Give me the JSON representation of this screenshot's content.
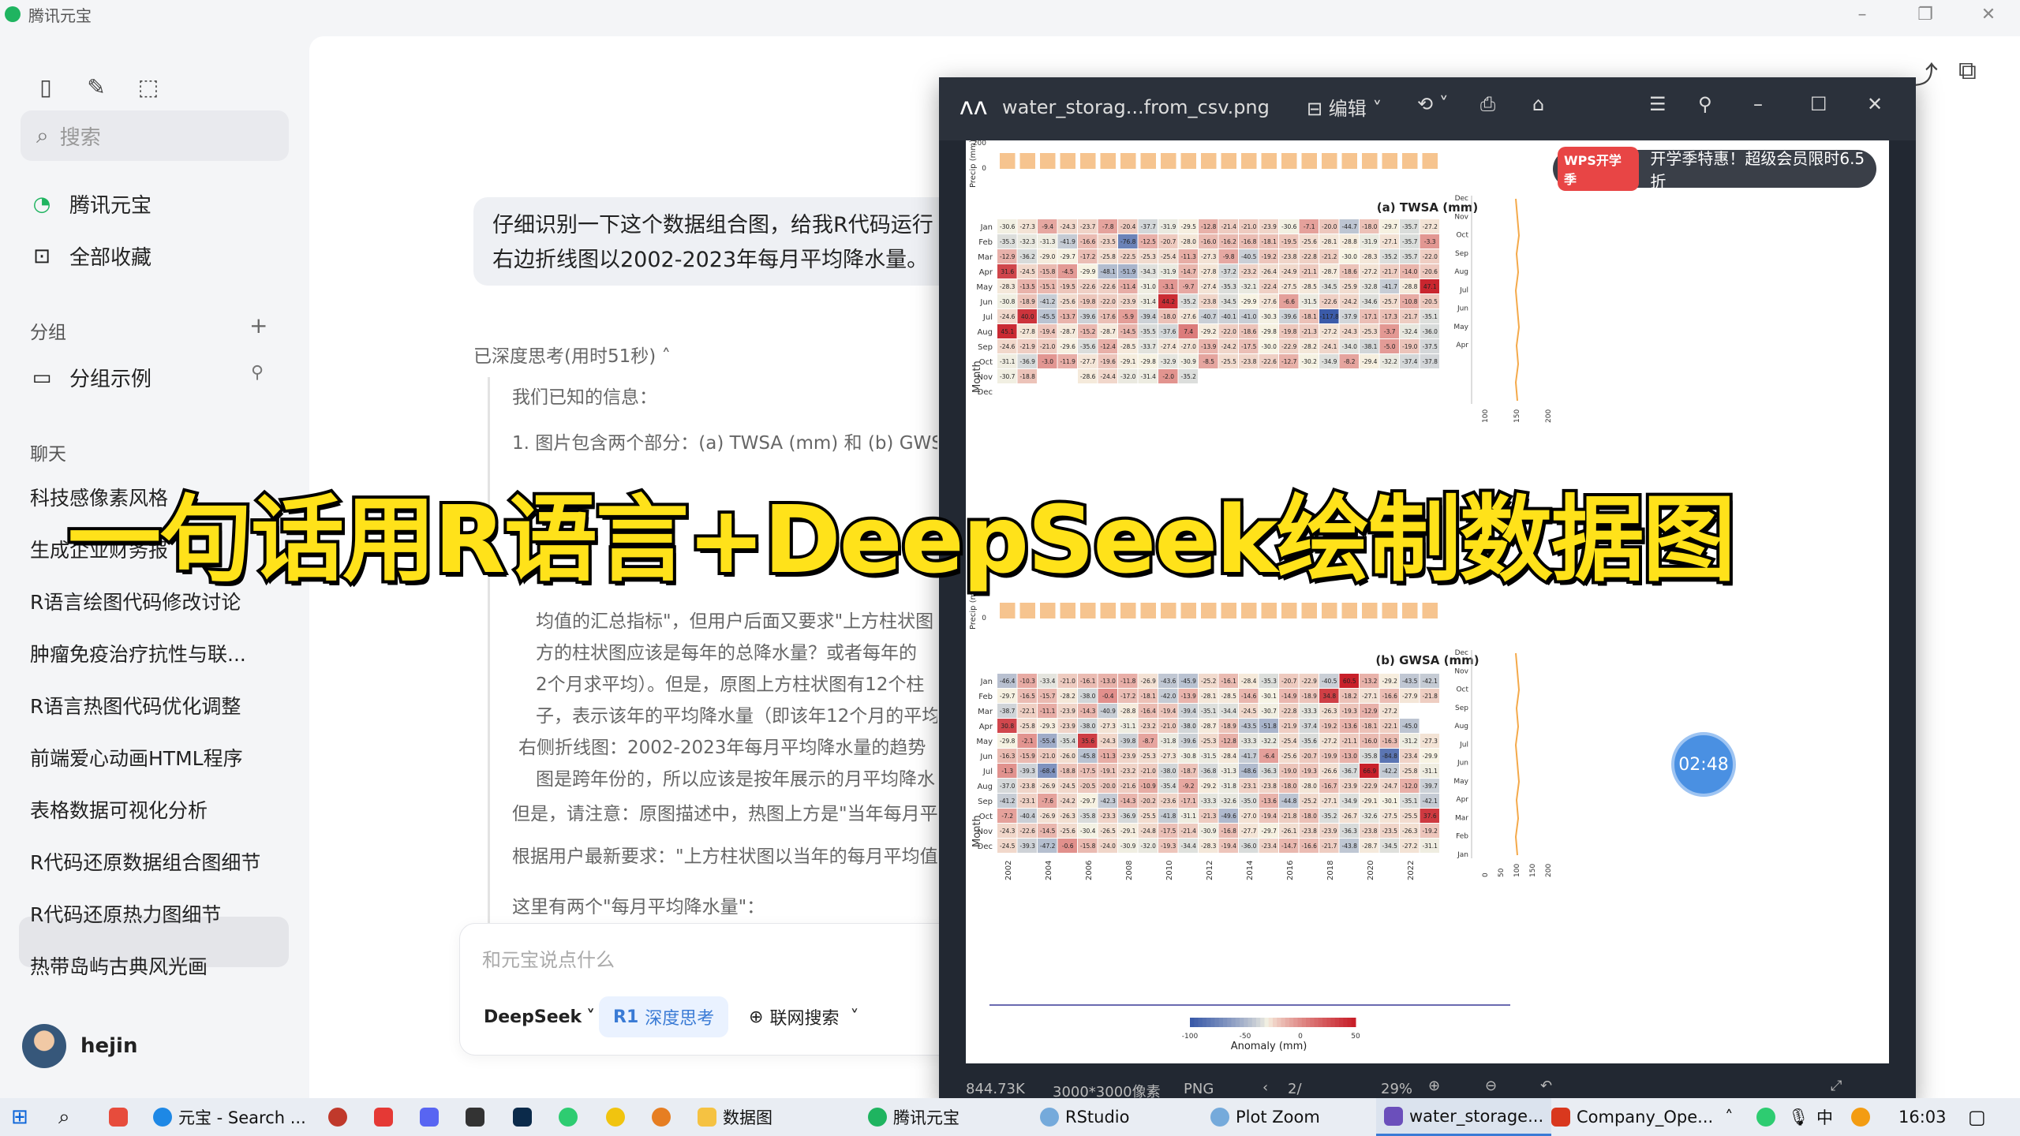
{
  "window": {
    "title": "腾讯元宝"
  },
  "sidebar": {
    "search_placeholder": "搜索",
    "nav": [
      {
        "label": "腾讯元宝"
      },
      {
        "label": "全部收藏"
      }
    ],
    "groups_label": "分组",
    "group_items": [
      {
        "label": "分组示例"
      }
    ],
    "chats_label": "聊天",
    "chats": [
      {
        "label": "科技感像素风格"
      },
      {
        "label": "生成企业财务报"
      },
      {
        "label": "R语言绘图代码修改讨论"
      },
      {
        "label": "肿瘤免疫治疗抗性与联..."
      },
      {
        "label": "R语言热图代码优化调整"
      },
      {
        "label": "前端爱心动画HTML程序"
      },
      {
        "label": "表格数据可视化分析"
      },
      {
        "label": "R代码还原数据组合图细节"
      },
      {
        "label": "R代码还原热力图细节"
      },
      {
        "label": "热带岛屿古典风光画"
      }
    ],
    "active_chat_index": 8,
    "user_name": "hejin"
  },
  "conversation": {
    "user_message_line1": "仔细识别一下这个数据组合图，给我R代码运行",
    "user_message_line2": "右边折线图以2002-2023年每月平均降水量。",
    "thinking_status": "已深度思考(用时51秒)",
    "reasoning": [
      "我们已知的信息：",
      "1. 图片包含两个部分：(a) TWSA (mm) 和 (b) GWSA (m",
      "均值的汇总指标\"，但用户后面又要求\"上方柱状图",
      "方的柱状图应该是每年的总降水量？或者每年的",
      "2个月求平均）。但是，原图上方柱状图有12个柱",
      "子，表示该年的平均降水量（即该年12个月的平均",
      "右侧折线图：2002-2023年每月平均降水量的趋势",
      "图是跨年份的，所以应该是按年展示的月平均降水",
      "但是，请注意：原图描述中，热图上方是\"当年每月平",
      "根据用户最新要求：\"上方柱状图以当年的每月平均值",
      "这里有两个\"每月平均降水量\"："
    ],
    "input_placeholder": "和元宝说点什么",
    "model_label": "DeepSeek",
    "deep_think_label": "深度思考",
    "deep_think_badge": "R1",
    "web_search_label": "联网搜索"
  },
  "viewer": {
    "filename": "water_storag...from_csv.png",
    "edit_label": "编辑",
    "status_size": "844.73K",
    "status_dims": "3000*3000像素",
    "status_format": "PNG",
    "status_page": "2/",
    "status_zoom": "29%",
    "banner_tag": "WPS开学季",
    "banner_text": "开学季特惠！超级会员限时6.5折",
    "timer": "02:48"
  },
  "overlay_title": "一句话用R语言+DeepSeek绘制数据图",
  "chart_data": [
    {
      "type": "heatmap",
      "title": "(a) TWSA (mm)",
      "ylabel": "Month",
      "rows": [
        "Jan",
        "Feb",
        "Mar",
        "Apr",
        "May",
        "Jun",
        "Jul",
        "Aug",
        "Sep",
        "Oct",
        "Nov",
        "Dec"
      ],
      "top_bar": {
        "ylabel": "Precip (mm)",
        "ticks": [
          0,
          200
        ]
      },
      "right_line": {
        "ticks": [
          100,
          150,
          200
        ]
      },
      "values": [
        [
          -30.6,
          -27.3,
          -9.4,
          -24.3,
          -23.7,
          -7.8,
          -20.4,
          -37.7,
          -31.9,
          -29.5,
          -12.8,
          -21.4,
          -21.0,
          -23.9,
          -30.6,
          -7.1,
          -20.0,
          -44.7,
          -18.0,
          -29.7,
          -35.7,
          -27.2
        ],
        [
          -35.3,
          -32.3,
          -31.3,
          -41.9,
          -16.6,
          -23.5,
          -76.8,
          -12.5,
          -20.7,
          -28.0,
          -16.0,
          -16.2,
          -16.8,
          -18.1,
          -19.5,
          -25.6,
          -28.1,
          -28.8,
          -31.9,
          -27.1,
          -35.7,
          -3.3
        ],
        [
          -12.9,
          -36.2,
          -29.0,
          -29.7,
          -17.2,
          -25.8,
          -22.5,
          -25.3,
          -25.4,
          -11.3,
          -27.3,
          -9.8,
          -40.5,
          -19.2,
          -23.8,
          -22.8,
          -21.2,
          -30.0,
          -28.3,
          -35.2,
          -35.7,
          -22.0
        ],
        [
          31.6,
          -24.5,
          -15.8,
          -4.5,
          -29.9,
          -48.1,
          -51.9,
          -34.3,
          -31.9,
          -14.7,
          -27.8,
          -37.2,
          -23.2,
          -26.4,
          -24.9,
          -21.1,
          -28.7,
          -18.6,
          -27.2,
          -21.7,
          -14.0,
          -20.6
        ],
        [
          -28.3,
          -13.5,
          -15.1,
          -19.5,
          -22.6,
          -22.6,
          -11.4,
          -31.0,
          -3.1,
          -9.7,
          -27.4,
          -35.3,
          -32.1,
          -22.4,
          -27.5,
          -28.5,
          -34.5,
          -25.9,
          -32.8,
          -41.7,
          -28.8,
          47.1
        ],
        [
          -30.8,
          -18.9,
          -41.2,
          -25.6,
          -19.8,
          -22.0,
          -23.9,
          -31.4,
          44.2,
          -35.2,
          -23.8,
          -34.5,
          -29.9,
          -27.6,
          -6.6,
          -31.5,
          -22.6,
          -24.2,
          -34.6,
          -25.7,
          -10.8,
          -20.5
        ],
        [
          -24.6,
          40.0,
          -45.5,
          -13.7,
          -39.6,
          -17.6,
          -5.9,
          -39.4,
          -18.0,
          -27.6,
          -40.7,
          -40.1,
          -41.0,
          -30.3,
          -39.6,
          -18.1,
          -117.8,
          -37.9,
          -17.1,
          -17.3,
          -21.7,
          -35.1
        ],
        [
          45.1,
          -27.8,
          -19.4,
          -28.7,
          -15.2,
          -28.7,
          -14.5,
          -35.5,
          -37.6,
          7.4,
          -29.2,
          -22.0,
          -18.6,
          -29.8,
          -19.8,
          -21.3,
          -27.2,
          -24.3,
          -25.3,
          -3.7,
          -32.4,
          -36.0
        ],
        [
          -24.6,
          -21.9,
          -21.0,
          -29.6,
          -35.6,
          -12.4,
          -28.5,
          -33.7,
          -27.4,
          -27.0,
          -13.9,
          -24.2,
          -17.5,
          -30.0,
          -22.9,
          -28.2,
          -24.1,
          -34.0,
          -38.1,
          -5.0,
          -19.0,
          -37.5
        ],
        [
          -31.1,
          -36.9,
          -3.0,
          -11.9,
          -27.7,
          -19.6,
          -29.1,
          -29.8,
          -32.9,
          -30.9,
          -8.5,
          -25.5,
          -23.8,
          -22.6,
          -12.7,
          -30.2,
          -34.9,
          -8.2,
          -29.4,
          -32.2,
          -37.4,
          -37.8
        ],
        [
          -30.7,
          -18.8,
          null,
          null,
          -28.6,
          -24.4,
          -32.0,
          -31.4,
          -2.0,
          -35.2,
          null,
          null,
          null,
          null,
          null,
          null,
          null,
          null,
          null,
          null,
          null,
          null
        ],
        [
          null,
          null,
          null,
          null,
          null,
          null,
          null,
          null,
          null,
          null,
          null,
          null,
          null,
          null,
          null,
          null,
          null,
          null,
          null,
          null,
          null,
          null
        ]
      ]
    },
    {
      "type": "heatmap",
      "title": "(b) GWSA (mm)",
      "ylabel": "Month",
      "rows": [
        "Jan",
        "Feb",
        "Mar",
        "Apr",
        "May",
        "Jun",
        "Jul",
        "Aug",
        "Sep",
        "Oct",
        "Nov",
        "Dec"
      ],
      "x_ticks": [
        "2002",
        "2004",
        "2006",
        "2008",
        "2010",
        "2012",
        "2014",
        "2016",
        "2018",
        "2020",
        "2022"
      ],
      "top_bar": {
        "ylabel": "Precip (mm)",
        "ticks": [
          0,
          200
        ]
      },
      "right_line": {
        "ticks": [
          0,
          50,
          100,
          150,
          200
        ],
        "months": [
          "Dec",
          "Nov",
          "Oct",
          "Sep",
          "Aug",
          "Jul",
          "Jun",
          "May",
          "Apr",
          "Mar",
          "Feb",
          "Jan"
        ]
      },
      "legend": {
        "title": "Anomaly (mm)",
        "ticks": [
          -100,
          -50,
          0,
          50
        ]
      },
      "values": [
        [
          -46.4,
          -10.3,
          -33.4,
          -21.0,
          -16.1,
          -13.0,
          -11.8,
          -26.9,
          -43.6,
          -45.9,
          -25.2,
          -16.1,
          -28.4,
          -35.3,
          -20.7,
          -22.9,
          -40.5,
          60.5,
          -13.2,
          -29.2,
          -43.5,
          -42.1
        ],
        [
          -29.7,
          -16.5,
          -15.7,
          -28.2,
          -38.0,
          -0.4,
          -17.2,
          -18.1,
          -42.0,
          -13.9,
          -28.1,
          -28.5,
          -14.6,
          -30.1,
          -14.9,
          -18.9,
          34.8,
          -18.2,
          -27.1,
          -16.6,
          -27.9,
          -21.8
        ],
        [
          -38.7,
          -22.1,
          -11.1,
          -23.9,
          -14.3,
          -40.9,
          -28.8,
          -16.4,
          -19.4,
          -39.4,
          -35.1,
          -34.4,
          -24.5,
          -30.7,
          -22.8,
          -33.3,
          -26.3,
          -19.3,
          -12.9,
          -27.2,
          null,
          null
        ],
        [
          30.8,
          -25.8,
          -29.3,
          -23.9,
          -38.0,
          -27.3,
          -31.1,
          -23.2,
          -21.0,
          -38.0,
          -28.7,
          -18.9,
          -43.5,
          -51.8,
          -21.9,
          -37.4,
          -19.2,
          -13.6,
          -18.1,
          -22.1,
          -45.0,
          null
        ],
        [
          -29.8,
          -2.1,
          -55.4,
          -35.4,
          35.6,
          -24.3,
          -39.8,
          -8.7,
          -31.8,
          -39.6,
          -25.3,
          -12.8,
          -33.3,
          -32.2,
          -25.4,
          -35.6,
          -27.2,
          -21.1,
          -16.0,
          -16.3,
          -31.2,
          -27.3
        ],
        [
          -16.3,
          -15.9,
          -21.0,
          -26.0,
          -45.8,
          -11.3,
          -23.9,
          -25.3,
          -27.3,
          -30.8,
          -31.5,
          -28.4,
          -41.7,
          -6.4,
          -25.6,
          -20.7,
          -19.9,
          -13.0,
          -35.8,
          -84.8,
          -23.4,
          -29.9
        ],
        [
          -1.3,
          -39.3,
          -68.4,
          -18.8,
          -17.5,
          -19.1,
          -23.2,
          -21.0,
          -38.0,
          -18.7,
          -36.8,
          -31.3,
          -48.6,
          -36.3,
          -19.0,
          -19.3,
          -26.6,
          -36.7,
          66.9,
          -42.2,
          -25.8,
          -31.1
        ],
        [
          -37.0,
          -23.8,
          -26.9,
          -24.5,
          -20.5,
          -20.0,
          -21.6,
          -10.9,
          -35.4,
          -9.2,
          -29.2,
          -31.8,
          -23.1,
          -23.8,
          -18.0,
          -28.0,
          -16.7,
          -23.9,
          -22.9,
          -24.7,
          -12.0,
          -39.7
        ],
        [
          -41.2,
          -23.1,
          -7.6,
          -24.2,
          -29.7,
          -42.3,
          -14.3,
          -20.2,
          -23.6,
          -17.1,
          -33.3,
          -32.6,
          -35.0,
          -13.6,
          -44.8,
          -25.2,
          -27.1,
          -34.9,
          -29.1,
          -30.1,
          -35.1,
          -42.1
        ],
        [
          -7.2,
          -40.4,
          -26.9,
          -26.3,
          -35.8,
          -23.3,
          -36.9,
          -25.5,
          -41.8,
          -31.1,
          -21.3,
          -49.6,
          -27.0,
          -19.4,
          -21.8,
          -18.0,
          -35.2,
          -26.7,
          -32.6,
          -27.5,
          -25.5,
          37.6
        ],
        [
          -24.3,
          -22.6,
          -14.5,
          -25.6,
          -30.4,
          -26.5,
          -29.1,
          -24.8,
          -17.5,
          -21.4,
          -30.9,
          -16.8,
          -27.7,
          -29.7,
          -26.1,
          -23.8,
          -23.9,
          -36.3,
          -23.8,
          -23.5,
          -26.3,
          -19.2
        ],
        [
          -24.5,
          -39.3,
          -47.2,
          -0.6,
          -15.8,
          -24.0,
          -30.9,
          -32.0,
          -19.3,
          -34.4,
          -28.3,
          -19.4,
          -36.0,
          -23.4,
          -14.7,
          -16.6,
          -21.7,
          -43.8,
          -28.7,
          -34.5,
          -27.2,
          -31.1
        ]
      ]
    }
  ],
  "taskbar": {
    "items": [
      {
        "label": "元宝 - Search ..."
      },
      {
        "label": "数据图"
      },
      {
        "label": "腾讯元宝"
      },
      {
        "label": "RStudio"
      },
      {
        "label": "Plot Zoom"
      },
      {
        "label": "water_storage..."
      },
      {
        "label": "Company_Ope..."
      }
    ],
    "clock": "16:03"
  },
  "colors": {
    "accent": "#1fb460",
    "heat_low": "#3b5ba9",
    "heat_mid": "#f7f4e4",
    "heat_high": "#c8202a",
    "overlay_text": "#ffe21a",
    "bars": "#f6c48f"
  }
}
